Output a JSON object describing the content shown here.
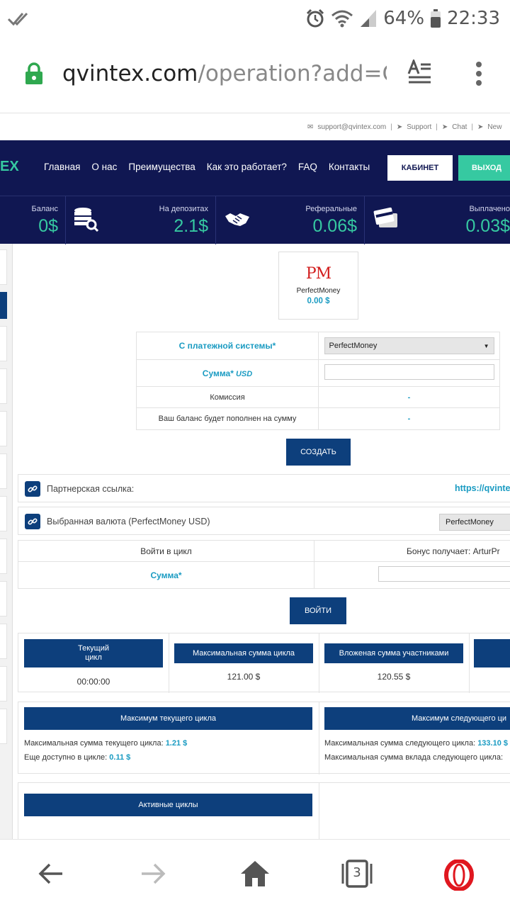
{
  "status_bar": {
    "battery_percent": "64%",
    "time": "22:33",
    "icons": [
      "double-check-icon",
      "alarm-icon",
      "wifi-icon",
      "signal-icon",
      "battery-icon"
    ]
  },
  "browser": {
    "url_host": "qvintex.com",
    "url_path": "/operation?add=CASH",
    "tab_count": "3"
  },
  "site": {
    "top_links": [
      "support@qvintex.com",
      "Support",
      "Chat",
      "New"
    ],
    "logo_fragment": "EX",
    "nav": [
      "Главная",
      "О нас",
      "Преимущества",
      "Как это работает?",
      "FAQ",
      "Контакты"
    ],
    "cabinet_label": "КАБИНЕТ",
    "exit_label": "ВЫХОД",
    "accent_color": "#36c9a1",
    "navy_color": "#101752",
    "stats": {
      "balance_label": "Баланс",
      "balance_value": "0$",
      "deposits_label": "На депозитах",
      "deposits_value": "2.1$",
      "referral_label": "Реферальные",
      "referral_value": "0.06$",
      "paid_label": "Выплачено",
      "paid_value": "0.03$"
    }
  },
  "wallet": {
    "logo": "PM",
    "name": "PerfectMoney",
    "amount": "0.00 $"
  },
  "payment_form": {
    "system_label": "С платежной системы*",
    "system_value": "PerfectMoney",
    "amount_label": "Сумма*",
    "amount_currency": "USD",
    "amount_value": "",
    "fee_label": "Комиссия",
    "fee_value": "-",
    "credited_label": "Ваш баланс будет пополнен на сумму",
    "credited_value": "-",
    "submit_label": "СОЗДАТЬ"
  },
  "partner": {
    "label": "Партнерская ссылка:",
    "link_fragment": "https://qvinte"
  },
  "currency": {
    "label": "Выбранная валюта (PerfectMoney USD)",
    "select_value": "PerfectMoney"
  },
  "cycle_form": {
    "enter_label": "Войти в цикл",
    "bonus_label": "Бонус получает: ArturPr",
    "amount_label": "Сумма*",
    "amount_value": "",
    "submit_label": "ВОЙТИ"
  },
  "cycle_stats": {
    "current_cycle_title_1": "Текущий",
    "current_cycle_title_2": "цикл",
    "current_cycle_value": "00:00:00",
    "max_sum_title": "Максимальная сумма цикла",
    "max_sum_value": "121.00 $",
    "invested_title": "Вложеная сумма участниками",
    "invested_value": "120.55 $"
  },
  "cycle_limits": {
    "current_title": "Максимум текущего цикла",
    "current_max_label": "Максимальная сумма текущего цикла:",
    "current_max_value": "1.21 $",
    "available_label": "Еще доступно в цикле:",
    "available_value": "0.11 $",
    "next_title": "Максимум следующего ци",
    "next_max_label": "Максимальная сумма следующего цикла:",
    "next_max_value": "133.10 $",
    "next_deposit_label": "Максимальная сумма вклада следующего цикла:"
  },
  "active_cycles": {
    "title": "Активные циклы"
  }
}
